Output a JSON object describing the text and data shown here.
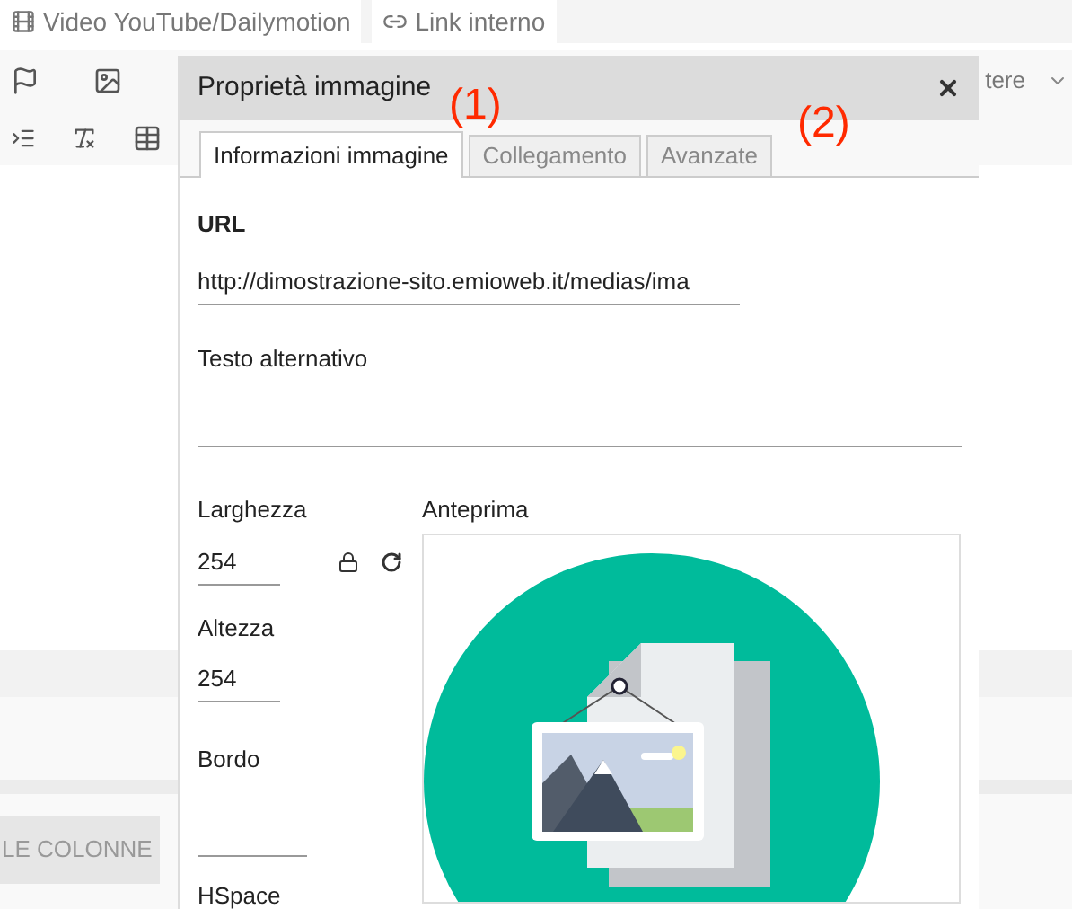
{
  "top_links": [
    {
      "label": "Video YouTube/Dailymotion"
    },
    {
      "label": "Link interno"
    }
  ],
  "dropdown": {
    "label": "tere"
  },
  "bottom_button": {
    "label": "LE COLONNE"
  },
  "dialog": {
    "title": "Proprietà immagine",
    "tabs": [
      {
        "label": "Informazioni immagine",
        "selected": true
      },
      {
        "label": "Collegamento",
        "selected": false
      },
      {
        "label": "Avanzate",
        "selected": false
      }
    ],
    "url": {
      "label": "URL",
      "value": "http://dimostrazione-sito.emioweb.it/medias/ima"
    },
    "alt": {
      "label": "Testo alternativo"
    },
    "width": {
      "label": "Larghezza",
      "value": "254"
    },
    "height": {
      "label": "Altezza",
      "value": "254"
    },
    "border": {
      "label": "Bordo"
    },
    "hspace": {
      "label": "HSpace"
    },
    "preview": {
      "label": "Anteprima"
    }
  },
  "annotations": [
    {
      "label": "(1)"
    },
    {
      "label": "(2)"
    }
  ]
}
